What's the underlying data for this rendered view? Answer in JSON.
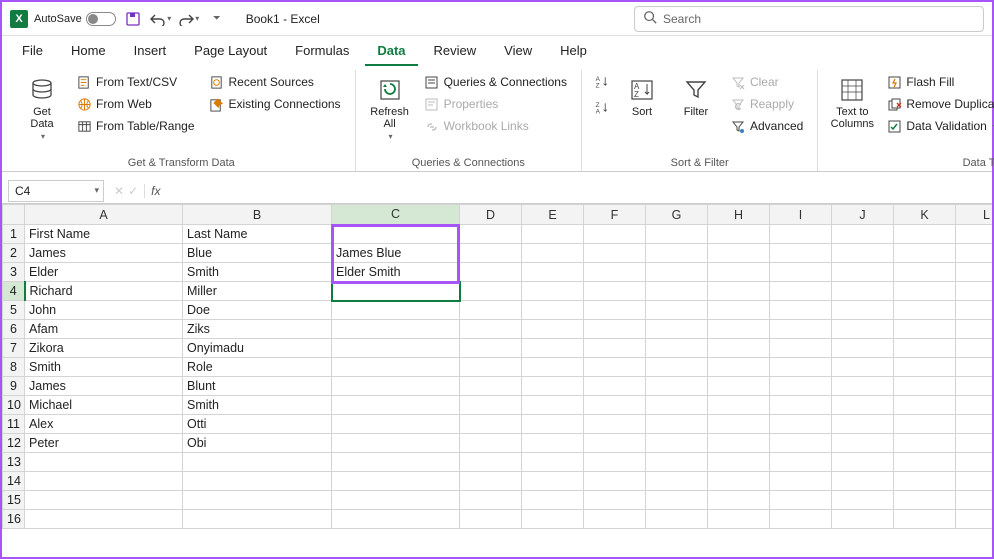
{
  "title": {
    "autosave_label": "AutoSave",
    "doc_name": "Book1 - Excel",
    "search_placeholder": "Search"
  },
  "tabs": [
    "File",
    "Home",
    "Insert",
    "Page Layout",
    "Formulas",
    "Data",
    "Review",
    "View",
    "Help"
  ],
  "active_tab": "Data",
  "ribbon": {
    "group1": {
      "label": "Get & Transform Data",
      "get_data": "Get Data",
      "from_txt": "From Text/CSV",
      "from_web": "From Web",
      "from_table": "From Table/Range",
      "recent": "Recent Sources",
      "existing": "Existing Connections"
    },
    "group2": {
      "label": "Queries & Connections",
      "refresh": "Refresh All",
      "queries": "Queries & Connections",
      "properties": "Properties",
      "workbook": "Workbook Links"
    },
    "group3": {
      "label": "Sort & Filter",
      "sort": "Sort",
      "filter": "Filter",
      "clear": "Clear",
      "reapply": "Reapply",
      "advanced": "Advanced"
    },
    "group4": {
      "label": "Data Tools",
      "text_cols": "Text to Columns",
      "flash": "Flash Fill",
      "dupes": "Remove Duplicates",
      "validation": "Data Validation"
    }
  },
  "namebox": "C4",
  "columns": [
    "A",
    "B",
    "C",
    "D",
    "E",
    "F",
    "G",
    "H",
    "I",
    "J",
    "K",
    "L"
  ],
  "active_col": "C",
  "active_row": 4,
  "rows": [
    {
      "n": 1,
      "a": "First Name",
      "b": "Last Name",
      "c": ""
    },
    {
      "n": 2,
      "a": "James",
      "b": "Blue",
      "c": "James Blue"
    },
    {
      "n": 3,
      "a": "Elder",
      "b": "Smith",
      "c": "Elder Smith"
    },
    {
      "n": 4,
      "a": "Richard",
      "b": "Miller",
      "c": ""
    },
    {
      "n": 5,
      "a": "John",
      "b": "Doe",
      "c": ""
    },
    {
      "n": 6,
      "a": "Afam",
      "b": "Ziks",
      "c": ""
    },
    {
      "n": 7,
      "a": "Zikora",
      "b": "Onyimadu",
      "c": ""
    },
    {
      "n": 8,
      "a": "Smith",
      "b": "Role",
      "c": ""
    },
    {
      "n": 9,
      "a": "James",
      "b": "Blunt",
      "c": ""
    },
    {
      "n": 10,
      "a": "Michael",
      "b": "Smith",
      "c": ""
    },
    {
      "n": 11,
      "a": "Alex",
      "b": "Otti",
      "c": ""
    },
    {
      "n": 12,
      "a": "Peter",
      "b": "Obi",
      "c": ""
    },
    {
      "n": 13,
      "a": "",
      "b": "",
      "c": ""
    },
    {
      "n": 14,
      "a": "",
      "b": "",
      "c": ""
    },
    {
      "n": 15,
      "a": "",
      "b": "",
      "c": ""
    },
    {
      "n": 16,
      "a": "",
      "b": "",
      "c": ""
    }
  ]
}
